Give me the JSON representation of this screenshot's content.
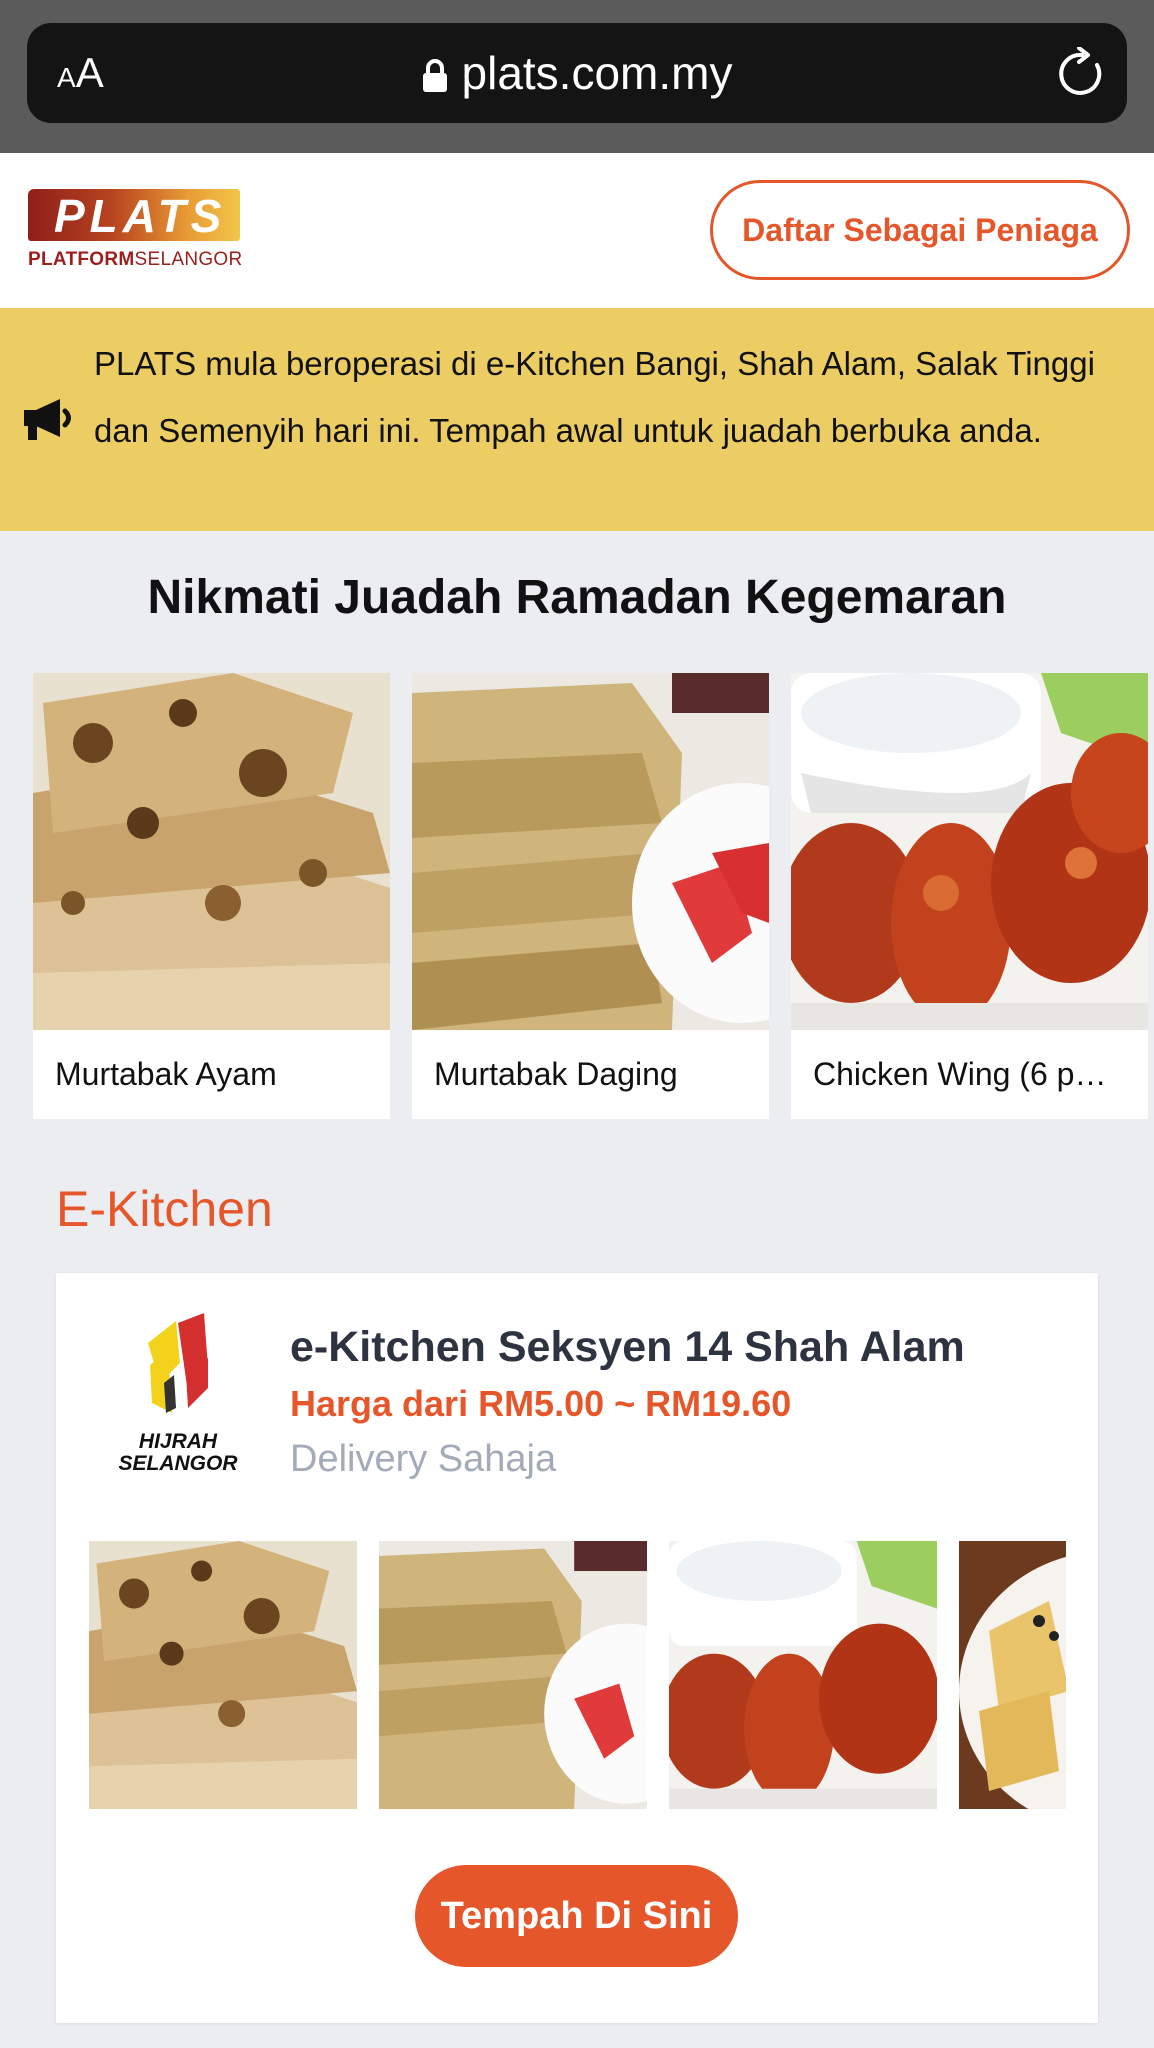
{
  "browser": {
    "text_size_label": "AA",
    "url": "plats.com.my",
    "icons": {
      "lock": "lock-icon",
      "reload": "reload-icon"
    }
  },
  "header": {
    "logo_main": "PLATS",
    "logo_sub_bold": "PLATFORM",
    "logo_sub_light": "SELANGOR",
    "seller_button": "Daftar Sebagai Peniaga"
  },
  "announcement": {
    "icon": "megaphone-icon",
    "text": "PLATS mula beroperasi di e-Kitchen Bangi, Shah Alam, Salak Tinggi dan Semenyih hari ini. Tempah awal untuk juadah berbuka anda."
  },
  "favorites": {
    "title": "Nikmati Juadah Ramadan Kegemaran",
    "items": [
      {
        "name": "Murtabak Ayam"
      },
      {
        "name": "Murtabak Daging"
      },
      {
        "name": "Chicken Wing (6 p…"
      }
    ]
  },
  "ekitchen": {
    "section_title": "E-Kitchen",
    "card": {
      "logo_text_1": "HIJRAH",
      "logo_text_2": "SELANGOR",
      "name": "e-Kitchen Seksyen 14 Shah Alam",
      "price": "Harga dari RM5.00 ~ RM19.60",
      "delivery": "Delivery Sahaja",
      "order_button": "Tempah Di Sini"
    }
  },
  "colors": {
    "accent": "#e5572a",
    "announcement_bg": "#eccd64",
    "page_bg": "#ecedf1",
    "chrome_bg": "#5b5b5b"
  }
}
